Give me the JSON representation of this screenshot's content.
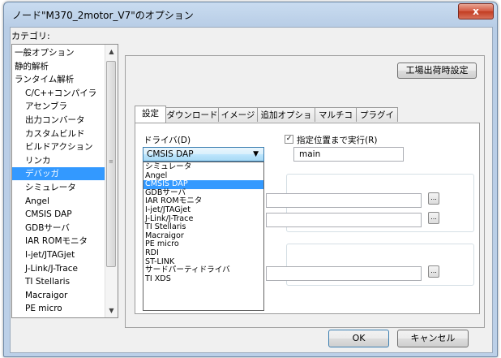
{
  "window": {
    "title": "ノード\"M370_2motor_V7\"のオプション",
    "close_label": "x"
  },
  "category": {
    "label": "カテゴリ:",
    "items": [
      {
        "label": "一般オプション",
        "level": 0
      },
      {
        "label": "静的解析",
        "level": 0
      },
      {
        "label": "ランタイム解析",
        "level": 0
      },
      {
        "label": "C/C++コンパイラ",
        "level": 1
      },
      {
        "label": "アセンブラ",
        "level": 1
      },
      {
        "label": "出力コンバータ",
        "level": 1
      },
      {
        "label": "カスタムビルド",
        "level": 1
      },
      {
        "label": "ビルドアクション",
        "level": 1
      },
      {
        "label": "リンカ",
        "level": 1
      },
      {
        "label": "デバッガ",
        "level": 1,
        "selected": true
      },
      {
        "label": "シミュレータ",
        "level": 1
      },
      {
        "label": "Angel",
        "level": 1
      },
      {
        "label": "CMSIS DAP",
        "level": 1
      },
      {
        "label": "GDBサーバ",
        "level": 1
      },
      {
        "label": "IAR ROMモニタ",
        "level": 1
      },
      {
        "label": "I-jet/JTAGjet",
        "level": 1
      },
      {
        "label": "J-Link/J-Trace",
        "level": 1
      },
      {
        "label": "TI Stellaris",
        "level": 1
      },
      {
        "label": "Macraigor",
        "level": 1
      },
      {
        "label": "PE micro",
        "level": 1
      }
    ],
    "scroll_up_icon": "triangle-up",
    "scroll_down_icon": "triangle-down",
    "scroll_grip_icon": "≡"
  },
  "factory_settings_label": "工場出荷時設定",
  "tabs": [
    "設定",
    "ダウンロード",
    "イメージ",
    "追加オプション",
    "マルチコア",
    "プラグイン"
  ],
  "driver": {
    "label": "ドライバ(D)",
    "selected": "CMSIS DAP",
    "options": [
      "シミュレータ",
      "Angel",
      "CMSIS DAP",
      "GDBサーバ",
      "IAR ROMモニタ",
      "I-jet/JTAGjet",
      "J-Link/J-Trace",
      "TI Stellaris",
      "Macraigor",
      "PE micro",
      "RDI",
      "ST-LINK",
      "サードパーティドライバ",
      "TI XDS"
    ]
  },
  "run_to": {
    "label": "指定位置まで実行(R)",
    "checked": true,
    "check_glyph": "✓",
    "value": "main"
  },
  "browse_label": "...",
  "buttons": {
    "ok": "OK",
    "cancel": "キャンセル"
  }
}
